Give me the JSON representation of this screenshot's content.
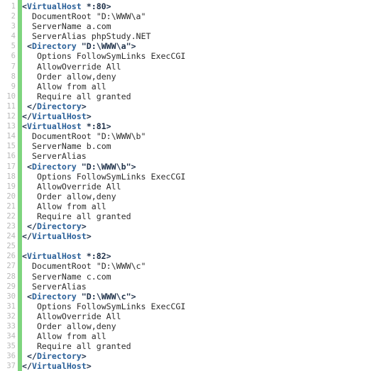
{
  "editor": {
    "kind": "code-editor",
    "file_type": "apache-vhost-conf",
    "background_color": "#ffffff",
    "gutter": {
      "line_number_color": "#b8b8b8",
      "change_bar_color": "#7ed47e",
      "change_bar_label": "modified-lines-indicator",
      "line_numbers": [
        "1",
        "2",
        "3",
        "4",
        "5",
        "6",
        "7",
        "8",
        "9",
        "10",
        "11",
        "12",
        "13",
        "14",
        "15",
        "16",
        "17",
        "18",
        "19",
        "20",
        "21",
        "22",
        "23",
        "24",
        "25",
        "26",
        "27",
        "28",
        "29",
        "30",
        "31",
        "32",
        "33",
        "34",
        "35",
        "36",
        "37"
      ]
    },
    "colors": {
      "tag_name": "#2a6099",
      "punctuation": "#20324a",
      "text": "#2b2b2b"
    },
    "lines": [
      {
        "n": "1",
        "indent": 0,
        "type": "tag-open",
        "segments": [
          {
            "t": "punct",
            "v": "<"
          },
          {
            "t": "tag",
            "v": "VirtualHost"
          },
          {
            "t": "punct",
            "v": " *:80>"
          }
        ]
      },
      {
        "n": "2",
        "indent": 2,
        "type": "directive",
        "segments": [
          {
            "t": "plain",
            "v": "DocumentRoot \"D:\\WWW\\a\""
          }
        ]
      },
      {
        "n": "3",
        "indent": 2,
        "type": "directive",
        "segments": [
          {
            "t": "plain",
            "v": "ServerName a.com"
          }
        ]
      },
      {
        "n": "4",
        "indent": 2,
        "type": "directive",
        "segments": [
          {
            "t": "plain",
            "v": "ServerAlias phpStudy.NET"
          }
        ]
      },
      {
        "n": "5",
        "indent": 1,
        "type": "tag-open",
        "segments": [
          {
            "t": "punct",
            "v": "<"
          },
          {
            "t": "tag",
            "v": "Directory"
          },
          {
            "t": "punct",
            "v": " \"D:\\WWW\\a\">"
          }
        ]
      },
      {
        "n": "6",
        "indent": 3,
        "type": "directive",
        "segments": [
          {
            "t": "plain",
            "v": "Options FollowSymLinks ExecCGI"
          }
        ]
      },
      {
        "n": "7",
        "indent": 3,
        "type": "directive",
        "segments": [
          {
            "t": "plain",
            "v": "AllowOverride All"
          }
        ]
      },
      {
        "n": "8",
        "indent": 3,
        "type": "directive",
        "segments": [
          {
            "t": "plain",
            "v": "Order allow,deny"
          }
        ]
      },
      {
        "n": "9",
        "indent": 3,
        "type": "directive",
        "segments": [
          {
            "t": "plain",
            "v": "Allow from all"
          }
        ]
      },
      {
        "n": "10",
        "indent": 3,
        "type": "directive",
        "segments": [
          {
            "t": "plain",
            "v": "Require all granted"
          }
        ]
      },
      {
        "n": "11",
        "indent": 1,
        "type": "tag-close",
        "segments": [
          {
            "t": "punct",
            "v": "</"
          },
          {
            "t": "tag",
            "v": "Directory"
          },
          {
            "t": "punct",
            "v": ">"
          }
        ]
      },
      {
        "n": "12",
        "indent": 0,
        "type": "tag-close",
        "segments": [
          {
            "t": "punct",
            "v": "</"
          },
          {
            "t": "tag",
            "v": "VirtualHost"
          },
          {
            "t": "punct",
            "v": ">"
          }
        ]
      },
      {
        "n": "13",
        "indent": 0,
        "type": "tag-open",
        "segments": [
          {
            "t": "punct",
            "v": "<"
          },
          {
            "t": "tag",
            "v": "VirtualHost"
          },
          {
            "t": "punct",
            "v": " *:81>"
          }
        ]
      },
      {
        "n": "14",
        "indent": 2,
        "type": "directive",
        "segments": [
          {
            "t": "plain",
            "v": "DocumentRoot \"D:\\WWW\\b\""
          }
        ]
      },
      {
        "n": "15",
        "indent": 2,
        "type": "directive",
        "segments": [
          {
            "t": "plain",
            "v": "ServerName b.com"
          }
        ]
      },
      {
        "n": "16",
        "indent": 2,
        "type": "directive",
        "segments": [
          {
            "t": "plain",
            "v": "ServerAlias"
          }
        ]
      },
      {
        "n": "17",
        "indent": 1,
        "type": "tag-open",
        "segments": [
          {
            "t": "punct",
            "v": "<"
          },
          {
            "t": "tag",
            "v": "Directory"
          },
          {
            "t": "punct",
            "v": " \"D:\\WWW\\b\">"
          }
        ]
      },
      {
        "n": "18",
        "indent": 3,
        "type": "directive",
        "segments": [
          {
            "t": "plain",
            "v": "Options FollowSymLinks ExecCGI"
          }
        ]
      },
      {
        "n": "19",
        "indent": 3,
        "type": "directive",
        "segments": [
          {
            "t": "plain",
            "v": "AllowOverride All"
          }
        ]
      },
      {
        "n": "20",
        "indent": 3,
        "type": "directive",
        "segments": [
          {
            "t": "plain",
            "v": "Order allow,deny"
          }
        ]
      },
      {
        "n": "21",
        "indent": 3,
        "type": "directive",
        "segments": [
          {
            "t": "plain",
            "v": "Allow from all"
          }
        ]
      },
      {
        "n": "22",
        "indent": 3,
        "type": "directive",
        "segments": [
          {
            "t": "plain",
            "v": "Require all granted"
          }
        ]
      },
      {
        "n": "23",
        "indent": 1,
        "type": "tag-close",
        "segments": [
          {
            "t": "punct",
            "v": "</"
          },
          {
            "t": "tag",
            "v": "Directory"
          },
          {
            "t": "punct",
            "v": ">"
          }
        ]
      },
      {
        "n": "24",
        "indent": 0,
        "type": "tag-close",
        "segments": [
          {
            "t": "punct",
            "v": "</"
          },
          {
            "t": "tag",
            "v": "VirtualHost"
          },
          {
            "t": "punct",
            "v": ">"
          }
        ]
      },
      {
        "n": "25",
        "indent": 0,
        "type": "blank",
        "segments": []
      },
      {
        "n": "26",
        "indent": 0,
        "type": "tag-open",
        "segments": [
          {
            "t": "punct",
            "v": "<"
          },
          {
            "t": "tag",
            "v": "VirtualHost"
          },
          {
            "t": "punct",
            "v": " *:82>"
          }
        ]
      },
      {
        "n": "27",
        "indent": 2,
        "type": "directive",
        "segments": [
          {
            "t": "plain",
            "v": "DocumentRoot \"D:\\WWW\\c\""
          }
        ]
      },
      {
        "n": "28",
        "indent": 2,
        "type": "directive",
        "segments": [
          {
            "t": "plain",
            "v": "ServerName c.com"
          }
        ]
      },
      {
        "n": "29",
        "indent": 2,
        "type": "directive",
        "segments": [
          {
            "t": "plain",
            "v": "ServerAlias"
          }
        ]
      },
      {
        "n": "30",
        "indent": 1,
        "type": "tag-open",
        "segments": [
          {
            "t": "punct",
            "v": "<"
          },
          {
            "t": "tag",
            "v": "Directory"
          },
          {
            "t": "punct",
            "v": " \"D:\\WWW\\c\">"
          }
        ]
      },
      {
        "n": "31",
        "indent": 3,
        "type": "directive",
        "segments": [
          {
            "t": "plain",
            "v": "Options FollowSymLinks ExecCGI"
          }
        ]
      },
      {
        "n": "32",
        "indent": 3,
        "type": "directive",
        "segments": [
          {
            "t": "plain",
            "v": "AllowOverride All"
          }
        ]
      },
      {
        "n": "33",
        "indent": 3,
        "type": "directive",
        "segments": [
          {
            "t": "plain",
            "v": "Order allow,deny"
          }
        ]
      },
      {
        "n": "34",
        "indent": 3,
        "type": "directive",
        "segments": [
          {
            "t": "plain",
            "v": "Allow from all"
          }
        ]
      },
      {
        "n": "35",
        "indent": 3,
        "type": "directive",
        "segments": [
          {
            "t": "plain",
            "v": "Require all granted"
          }
        ]
      },
      {
        "n": "36",
        "indent": 1,
        "type": "tag-close",
        "segments": [
          {
            "t": "punct",
            "v": "</"
          },
          {
            "t": "tag",
            "v": "Directory"
          },
          {
            "t": "punct",
            "v": ">"
          }
        ]
      },
      {
        "n": "37",
        "indent": 0,
        "type": "tag-close",
        "segments": [
          {
            "t": "punct",
            "v": "</"
          },
          {
            "t": "tag",
            "v": "VirtualHost"
          },
          {
            "t": "punct",
            "v": ">"
          }
        ]
      }
    ]
  }
}
